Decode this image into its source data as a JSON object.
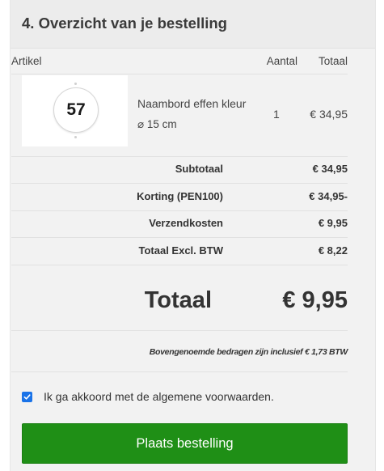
{
  "section": {
    "title": "4. Overzicht van je bestelling"
  },
  "table": {
    "headers": {
      "article": "Artikel",
      "quantity": "Aantal",
      "total": "Totaal"
    },
    "items": [
      {
        "image_number": "57",
        "name": "Naambord effen kleur",
        "size": "⌀ 15 cm",
        "quantity": "1",
        "total": "€ 34,95"
      }
    ]
  },
  "summary": {
    "subtotal": {
      "label": "Subtotaal",
      "value": "€ 34,95"
    },
    "discount": {
      "label": "Korting (PEN100)",
      "value": "€ 34,95-"
    },
    "shipping": {
      "label": "Verzendkosten",
      "value": "€ 9,95"
    },
    "total_excl_vat": {
      "label": "Totaal Excl. BTW",
      "value": "€ 8,22"
    },
    "grand_total": {
      "label": "Totaal",
      "value": "€ 9,95"
    },
    "vat_note": "Bovengenoemde bedragen zijn inclusief € 1,73 BTW"
  },
  "terms": {
    "checked": true,
    "label": "Ik ga akkoord met de algemene voorwaarden."
  },
  "order_button": {
    "label": "Plaats bestelling"
  },
  "colors": {
    "button": "#1f8f16",
    "checkbox": "#1a73e8",
    "panel": "#f2f2f2"
  },
  "icons": {
    "checkbox": "checkmark-icon",
    "size": "diameter-icon"
  }
}
